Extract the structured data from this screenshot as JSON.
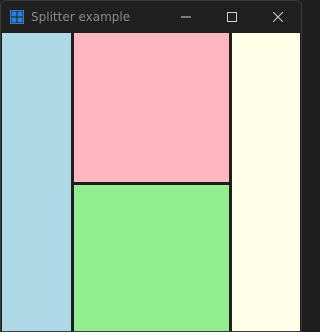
{
  "window": {
    "title": "Splitter example"
  },
  "titlebar": {
    "app_icon": "grid-app-icon",
    "controls": {
      "minimize_icon": "minimize-icon",
      "maximize_icon": "maximize-icon",
      "close_icon": "close-icon"
    }
  },
  "panes": {
    "left": {
      "color": "#add8e6"
    },
    "top_center": {
      "color": "#ffb6c1"
    },
    "bottom_center": {
      "color": "#90ee90"
    },
    "right": {
      "color": "#fffee6"
    }
  },
  "colors": {
    "titlebar_bg": "#202020",
    "splitter": "#1e1e1e",
    "title_text": "#8a8a8a",
    "icon_accent": "#2f7fd6"
  }
}
